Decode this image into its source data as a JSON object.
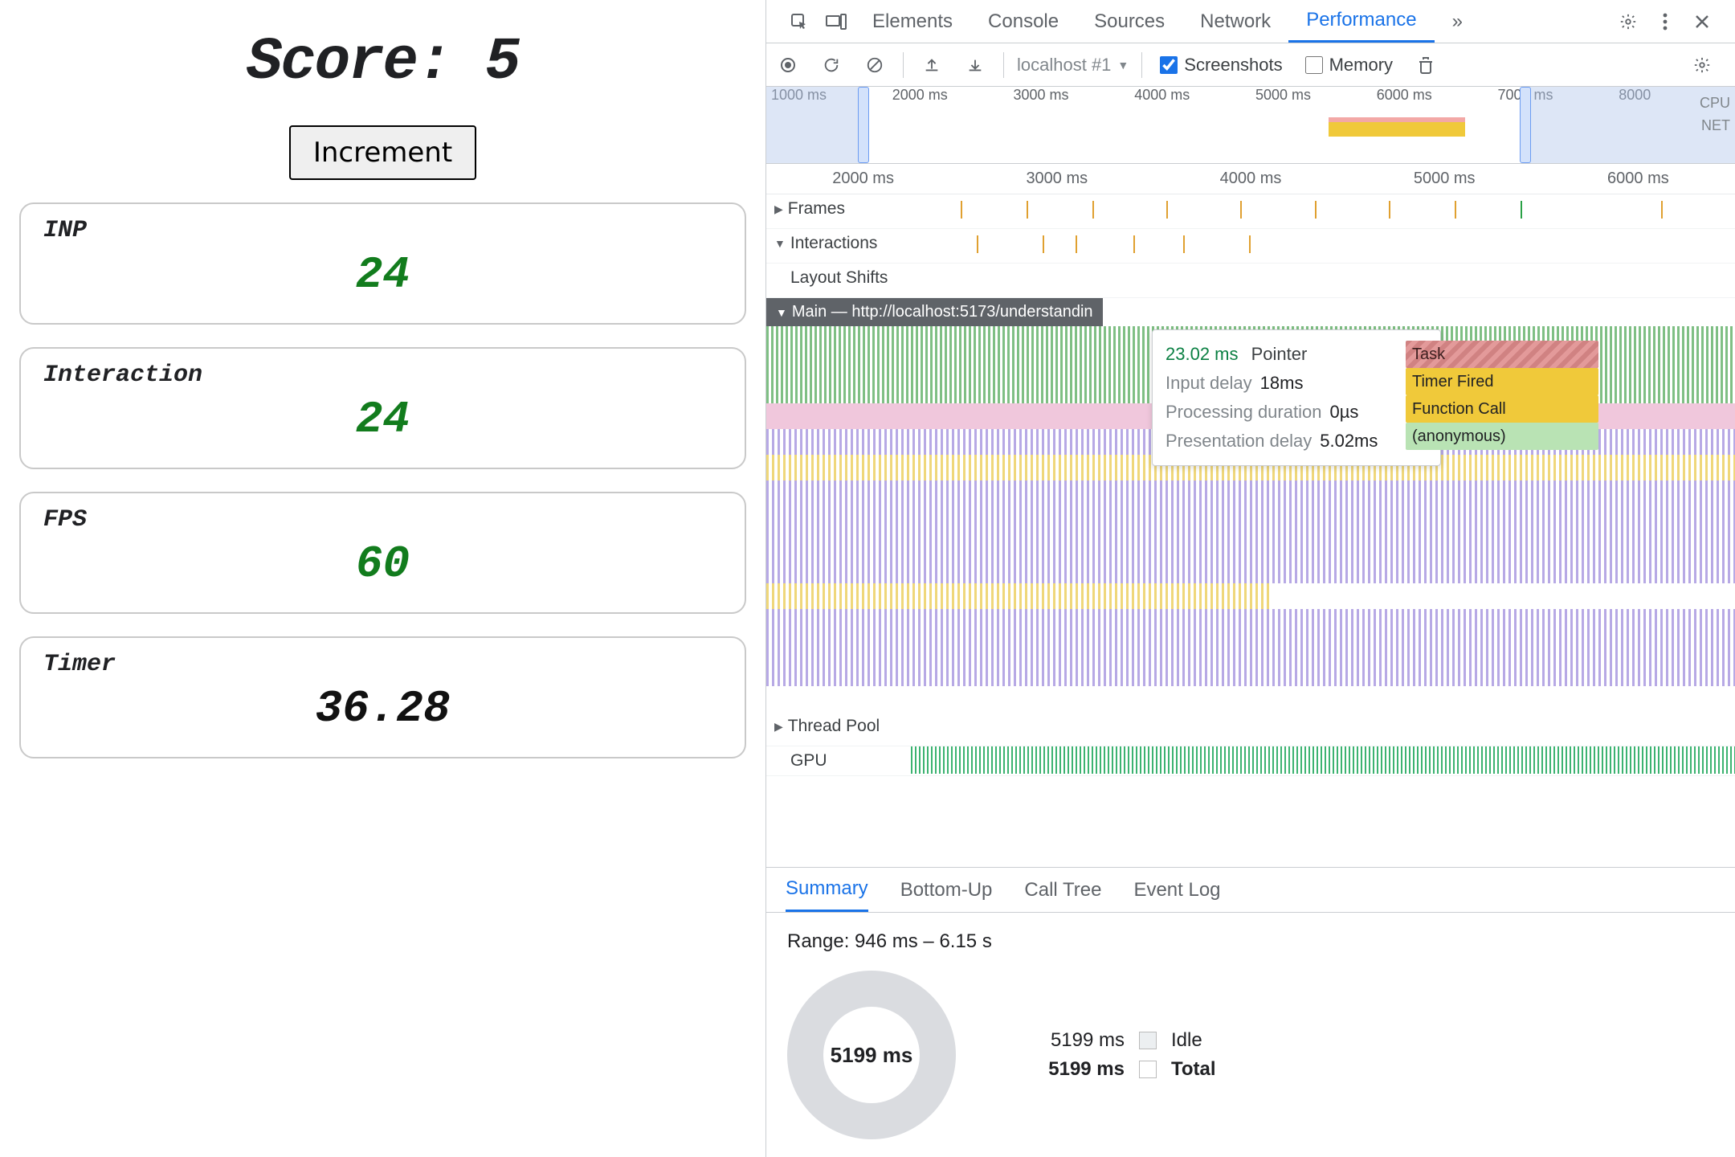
{
  "app": {
    "score_label": "Score:",
    "score_value": "5",
    "increment_label": "Increment",
    "cards": [
      {
        "label": "INP",
        "value": "24",
        "color": "green"
      },
      {
        "label": "Interaction",
        "value": "24",
        "color": "green"
      },
      {
        "label": "FPS",
        "value": "60",
        "color": "green"
      },
      {
        "label": "Timer",
        "value": "36.28",
        "color": "black"
      }
    ]
  },
  "devtools": {
    "tabs": {
      "elements": "Elements",
      "console": "Console",
      "sources": "Sources",
      "network": "Network",
      "performance": "Performance",
      "more": "»"
    },
    "toolbar": {
      "dropdown": "localhost #1",
      "screenshots_label": "Screenshots",
      "screenshots_checked": true,
      "memory_label": "Memory",
      "memory_checked": false
    },
    "overview": {
      "ticks": [
        "1000 ms",
        "2000 ms",
        "3000 ms",
        "4000 ms",
        "5000 ms",
        "6000 ms",
        "7000 ms",
        "8000"
      ],
      "side_labels": [
        "CPU",
        "NET"
      ]
    },
    "ruler": [
      "2000 ms",
      "3000 ms",
      "4000 ms",
      "5000 ms",
      "6000 ms"
    ],
    "tracks": {
      "frames": "Frames",
      "interactions": "Interactions",
      "layout_shifts": "Layout Shifts",
      "main": "Main — http://localhost:5173/understandin",
      "thread_pool": "Thread Pool",
      "gpu": "GPU"
    },
    "tooltip": {
      "duration_ms": "23.02 ms",
      "event_type": "Pointer",
      "rows": [
        {
          "k": "Input delay",
          "v": "18ms"
        },
        {
          "k": "Processing duration",
          "v": "0µs"
        },
        {
          "k": "Presentation delay",
          "v": "5.02ms"
        }
      ]
    },
    "stack": {
      "task": "Task",
      "timer_fired": "Timer Fired",
      "function_call": "Function Call",
      "anonymous": "(anonymous)"
    },
    "bottom_tabs": {
      "summary": "Summary",
      "bottom_up": "Bottom-Up",
      "call_tree": "Call Tree",
      "event_log": "Event Log"
    },
    "summary": {
      "range": "Range: 946 ms – 6.15 s",
      "donut_center": "5199 ms",
      "legend": [
        {
          "ms": "5199 ms",
          "label": "Idle",
          "bold": false
        },
        {
          "ms": "5199 ms",
          "label": "Total",
          "bold": true
        }
      ]
    }
  }
}
